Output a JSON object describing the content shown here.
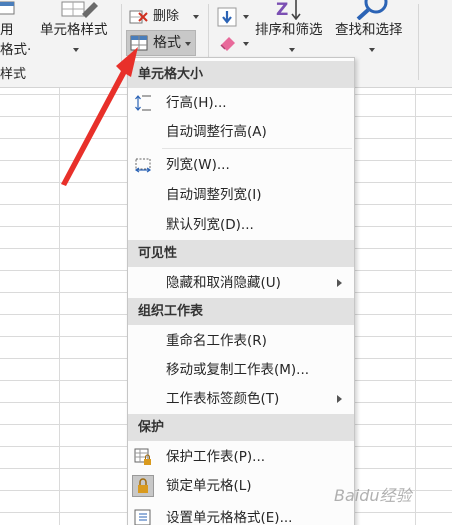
{
  "ribbon": {
    "styles_group": {
      "partial_top": "用",
      "partial_bottom": "格式·",
      "group_label_partial": "样式",
      "cell_styles_label": "单元格样式"
    },
    "cells_group": {
      "delete_label": "删除",
      "format_label": "格式"
    },
    "editing_group": {
      "sort_filter_label": "排序和筛选",
      "find_select_label": "查找和选择",
      "sort_glyph": "Z"
    }
  },
  "menu": {
    "sections": [
      {
        "header": "单元格大小",
        "items": [
          {
            "label": "行高(H)...",
            "icon": "row-height-icon"
          },
          {
            "label": "自动调整行高(A)"
          },
          {
            "label": "列宽(W)...",
            "icon": "column-width-icon"
          },
          {
            "label": "自动调整列宽(I)"
          },
          {
            "label": "默认列宽(D)..."
          }
        ]
      },
      {
        "header": "可见性",
        "items": [
          {
            "label": "隐藏和取消隐藏(U)",
            "submenu": true
          }
        ]
      },
      {
        "header": "组织工作表",
        "items": [
          {
            "label": "重命名工作表(R)"
          },
          {
            "label": "移动或复制工作表(M)..."
          },
          {
            "label": "工作表标签颜色(T)",
            "submenu": true
          }
        ]
      },
      {
        "header": "保护",
        "items": [
          {
            "label": "保护工作表(P)...",
            "icon": "protect-sheet-icon"
          },
          {
            "label": "锁定单元格(L)",
            "icon": "lock-icon"
          },
          {
            "label": "设置单元格格式(E)...",
            "icon": "format-cells-icon"
          }
        ]
      }
    ]
  },
  "watermark": "Baidu经验",
  "colors": {
    "annotation_arrow": "#e8302a",
    "section_header_bg": "#e1e1e1",
    "ribbon_bg": "#f3f3f3",
    "lock_icon": "#d99a1e"
  }
}
